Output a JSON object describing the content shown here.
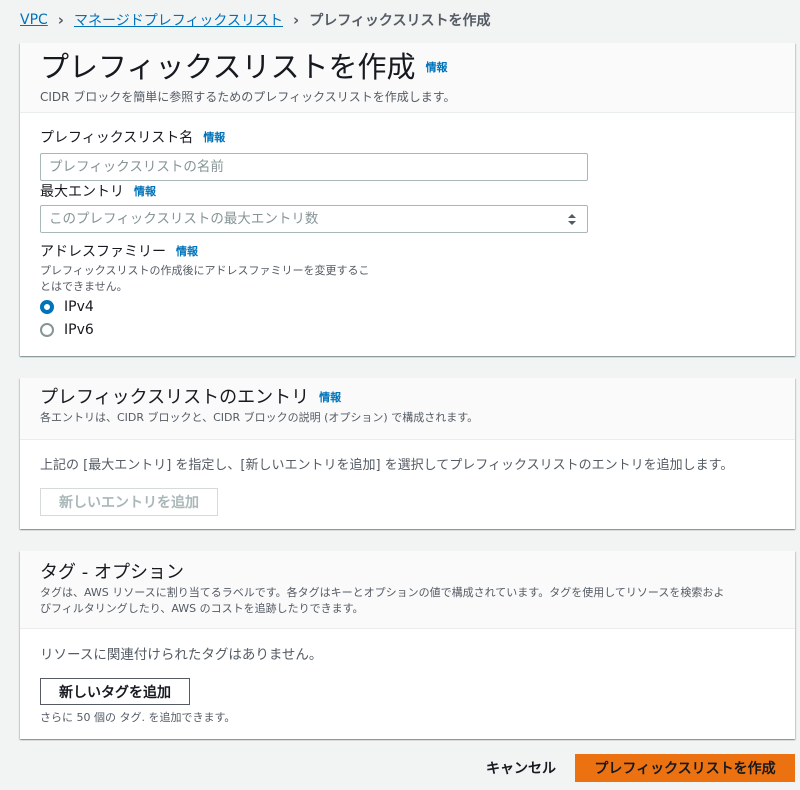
{
  "breadcrumb": {
    "items": [
      "VPC",
      "マネージドプレフィックスリスト"
    ],
    "current": "プレフィックスリストを作成"
  },
  "info_label": "情報",
  "main": {
    "title": "プレフィックスリストを作成",
    "description": "CIDR ブロックを簡単に参照するためのプレフィックスリストを作成します。",
    "name_field": {
      "label": "プレフィックスリスト名",
      "placeholder": "プレフィックスリストの名前",
      "value": ""
    },
    "max_entries_field": {
      "label": "最大エントリ",
      "placeholder": "このプレフィックスリストの最大エントリ数",
      "value": ""
    },
    "address_family": {
      "label": "アドレスファミリー",
      "description_line1": "プレフィックスリストの作成後にアドレスファミリーを変更するこ",
      "description_line2": "とはできません。",
      "options": [
        {
          "label": "IPv4",
          "selected": true
        },
        {
          "label": "IPv6",
          "selected": false
        }
      ]
    }
  },
  "entries": {
    "title": "プレフィックスリストのエントリ",
    "description": "各エントリは、CIDR ブロックと、CIDR ブロックの説明 (オプション) で構成されます。",
    "empty_text": "上記の [最大エントリ] を指定し、[新しいエントリを追加] を選択してプレフィックスリストのエントリを追加します。",
    "add_button": "新しいエントリを追加"
  },
  "tags": {
    "title": "タグ - オプション",
    "description_line1": "タグは、AWS リソースに割り当てるラベルです。各タグはキーとオプションの値で構成されています。タグを使用してリソースを検索およ",
    "description_line2": "びフィルタリングしたり、AWS のコストを追跡したりできます。",
    "empty_text": "リソースに関連付けられたタグはありません。",
    "add_button": "新しいタグを追加",
    "remaining_text": "さらに 50 個の タグ. を追加できます。"
  },
  "footer": {
    "cancel": "キャンセル",
    "create": "プレフィックスリストを作成"
  },
  "colors": {
    "link": "#0073bb",
    "primary_button": "#ec7211",
    "background": "#f2f3f3"
  }
}
